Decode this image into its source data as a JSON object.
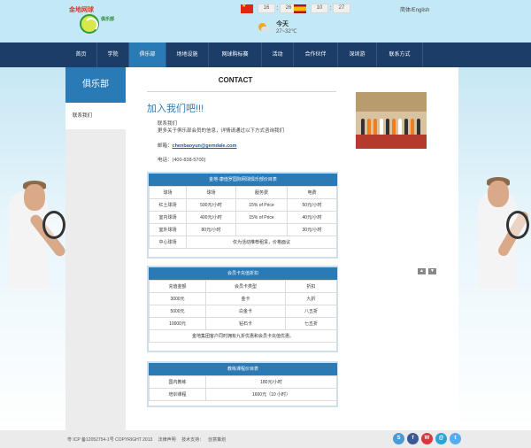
{
  "header": {
    "logo_text": "金地网球",
    "logo_subtext": "俱乐部",
    "clock_cn": {
      "h": "16",
      "m": "26"
    },
    "clock_es": {
      "h": "10",
      "m": "27"
    },
    "weather_day": "今天",
    "weather_temp": "27~32℃",
    "language_link": "简体/English"
  },
  "nav": [
    "首页",
    "学院",
    "俱乐部",
    "场地设施",
    "网球购标赛",
    "活动",
    "合作伙伴",
    "深圳游",
    "联系方式"
  ],
  "sidebar": {
    "title": "俱乐部",
    "items": [
      "联系我们"
    ]
  },
  "main": {
    "contact_title": "CONTACT",
    "join_title": "加入我们吧!!!",
    "intro_line1": "联系我们",
    "intro_line2": "更多关于俱乐部会员的信息，详情请通过以下方式咨询我们",
    "email_label": "邮箱：",
    "email": "chenbaoyun@gemdale.com",
    "phone_label": "电话：(400-838-5700)"
  },
  "table1": {
    "caption": "金地-康值罗国际网球俱乐部价目表",
    "headers": [
      "球场",
      "球场",
      "服务费",
      "电费"
    ],
    "rows": [
      [
        "红土球场",
        "500元/小时",
        "15% of Price",
        "50元/小时"
      ],
      [
        "室内球场",
        "400元/小时",
        "15% of Price",
        "40元/小时"
      ],
      [
        "室外球场",
        "80元/小时",
        "",
        "30元/小时"
      ]
    ],
    "last_row_label": "中心球场",
    "last_row_value": "仅为活动推荐租赁，价格面议"
  },
  "table2": {
    "caption": "会员卡充值折扣",
    "headers": [
      "充值金额",
      "会员卡类型",
      "折扣"
    ],
    "rows": [
      [
        "3000元",
        "金卡",
        "九折"
      ],
      [
        "5000元",
        "白金卡",
        "八五折"
      ],
      [
        "10000元",
        "钻石卡",
        "七五折"
      ]
    ],
    "note": "金地集团客户同时拥有九折优惠和会员卡充值优惠。"
  },
  "table3": {
    "caption": "教练课程价目表",
    "rows": [
      [
        "国内教练",
        "180元/小时"
      ],
      [
        "培训课程",
        "1600元（10 小时）"
      ]
    ]
  },
  "footer": {
    "icp": "粤 ICP 备12052754-1号 COPYRIGHT 2013",
    "legal": "法律声明",
    "support": "技术支持：",
    "support_link": "创意策划"
  },
  "socials": [
    "S",
    "f",
    "W",
    "@",
    "t"
  ],
  "colors": {
    "nav_bg": "#1b3d68",
    "accent": "#2a7ab6",
    "header_bg": "#c3e8f6"
  }
}
